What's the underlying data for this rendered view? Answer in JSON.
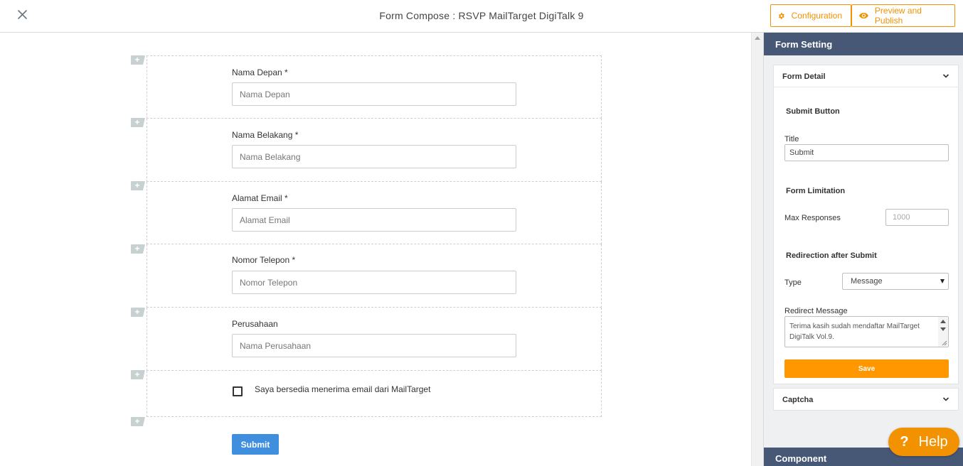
{
  "header": {
    "title": "Form Compose : RSVP MailTarget DigiTalk 9",
    "configuration_label": "Configuration",
    "preview_label": "Preview and Publish",
    "accent_color": "#f39200"
  },
  "form": {
    "fields": [
      {
        "label": "Nama Depan *",
        "placeholder": "Nama Depan"
      },
      {
        "label": "Nama Belakang *",
        "placeholder": "Nama Belakang"
      },
      {
        "label": "Alamat Email *",
        "placeholder": "Alamat Email"
      },
      {
        "label": "Nomor Telepon *",
        "placeholder": "Nomor Telepon"
      },
      {
        "label": "Perusahaan",
        "placeholder": "Nama Perusahaan"
      }
    ],
    "checkbox_label": "Saya bersedia menerima email dari MailTarget",
    "submit_label": "Submit",
    "add_symbol": "+"
  },
  "panel": {
    "title": "Form Setting",
    "form_detail": {
      "heading": "Form Detail",
      "submit_button_heading": "Submit Button",
      "title_label": "Title",
      "title_value": "Submit",
      "form_limitation_heading": "Form Limitation",
      "max_responses_label": "Max Responses",
      "max_responses_placeholder": "1000",
      "redirection_heading": "Redirection after Submit",
      "type_label": "Type",
      "type_value": "Message",
      "redirect_message_label": "Redirect Message",
      "redirect_message_value": "Terima kasih sudah mendaftar MailTarget DigiTalk Vol.9.",
      "save_label": "Save"
    },
    "captcha_heading": "Captcha",
    "component_heading": "Component"
  },
  "help": {
    "symbol": "?",
    "label": "Help"
  }
}
